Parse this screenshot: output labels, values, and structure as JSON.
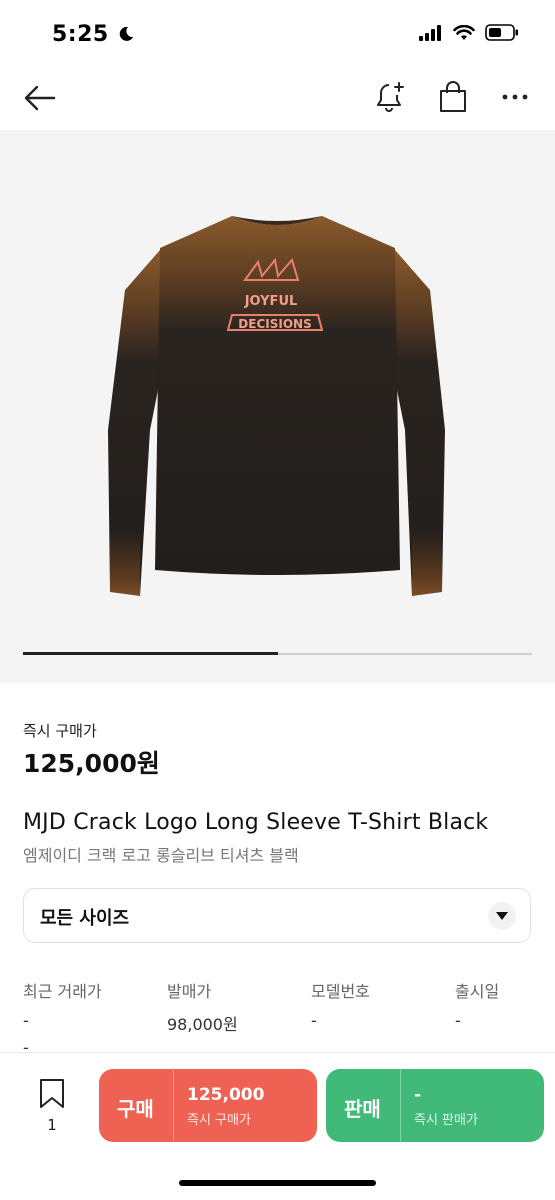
{
  "status_bar": {
    "time": "5:25"
  },
  "product": {
    "instant_buy_label": "즉시 구매가",
    "instant_buy_price": "125,000원",
    "name_en": "MJD Crack Logo Long Sleeve T-Shirt Black",
    "name_ko": "엠제이디 크랙 로고 롱슬리브 티셔츠 블랙",
    "image_progress": 0.5
  },
  "size_selector": {
    "label": "모든 사이즈"
  },
  "stats": [
    {
      "label": "최근 거래가",
      "value": "-",
      "value2": "-"
    },
    {
      "label": "발매가",
      "value": "98,000원"
    },
    {
      "label": "모델번호",
      "value": "-"
    },
    {
      "label": "출시일",
      "value": "-"
    }
  ],
  "bottom_bar": {
    "bookmark_count": "1",
    "buy": {
      "label": "구매",
      "price": "125,000",
      "sub": "즉시 구매가",
      "color": "#ef6253"
    },
    "sell": {
      "label": "판매",
      "price": "-",
      "sub": "즉시 판매가",
      "color": "#41b979"
    }
  }
}
